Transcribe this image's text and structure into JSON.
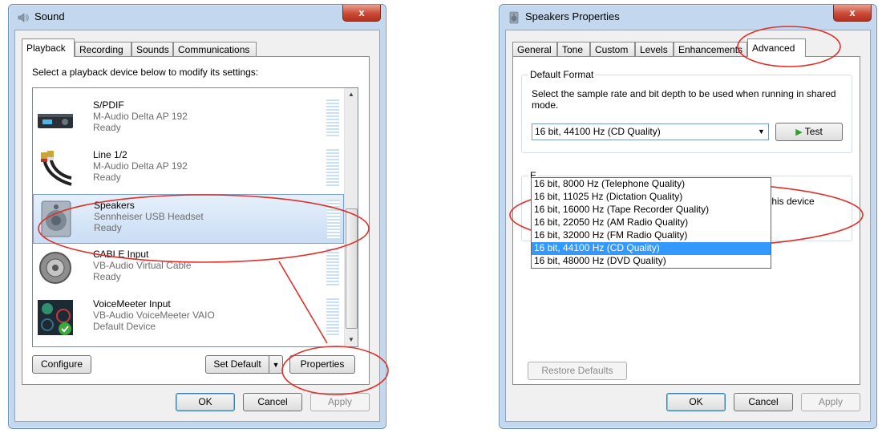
{
  "sound": {
    "title": "Sound",
    "close": "x",
    "tabs": [
      "Playback",
      "Recording",
      "Sounds",
      "Communications"
    ],
    "instruction": "Select a playback device below to modify its settings:",
    "devices": [
      {
        "name": "S/PDIF",
        "desc": "M-Audio Delta AP 192",
        "status": "Ready",
        "icon": "receiver-icon"
      },
      {
        "name": "Line 1/2",
        "desc": "M-Audio Delta AP 192",
        "status": "Ready",
        "icon": "rca-cable-icon"
      },
      {
        "name": "Speakers",
        "desc": "Sennheiser USB Headset",
        "status": "Ready",
        "icon": "speaker-icon"
      },
      {
        "name": "CABLE Input",
        "desc": "VB-Audio Virtual Cable",
        "status": "Ready",
        "icon": "virtual-cable-icon"
      },
      {
        "name": "VoiceMeeter Input",
        "desc": "VB-Audio VoiceMeeter VAIO",
        "status": "Default Device",
        "icon": "voicemeeter-icon"
      }
    ],
    "configure_label": "Configure",
    "set_default_label": "Set Default",
    "properties_label": "Properties",
    "ok_label": "OK",
    "cancel_label": "Cancel",
    "apply_label": "Apply"
  },
  "props": {
    "title": "Speakers Properties",
    "close": "x",
    "tabs": [
      "General",
      "Tone",
      "Custom",
      "Levels",
      "Enhancements",
      "Advanced"
    ],
    "default_format_label": "Default Format",
    "default_format_desc": "Select the sample rate and bit depth to be used when running in shared mode.",
    "selected_format": "16 bit, 44100 Hz (CD Quality)",
    "test_label": "Test",
    "options": [
      "16 bit, 8000 Hz (Telephone Quality)",
      "16 bit, 11025 Hz (Dictation Quality)",
      "16 bit, 16000 Hz (Tape Recorder Quality)",
      "16 bit, 22050 Hz (AM Radio Quality)",
      "16 bit, 32000 Hz (FM Radio Quality)",
      "16 bit, 44100 Hz (CD Quality)",
      "16 bit, 48000 Hz (DVD Quality)"
    ],
    "hidden_group_initial": "E",
    "hidden_text_fragment": "this device",
    "restore_defaults_label": "Restore Defaults",
    "ok_label": "OK",
    "cancel_label": "Cancel",
    "apply_label": "Apply"
  },
  "colors": {
    "annotation": "#e0302a",
    "selection": "#3399ff"
  }
}
